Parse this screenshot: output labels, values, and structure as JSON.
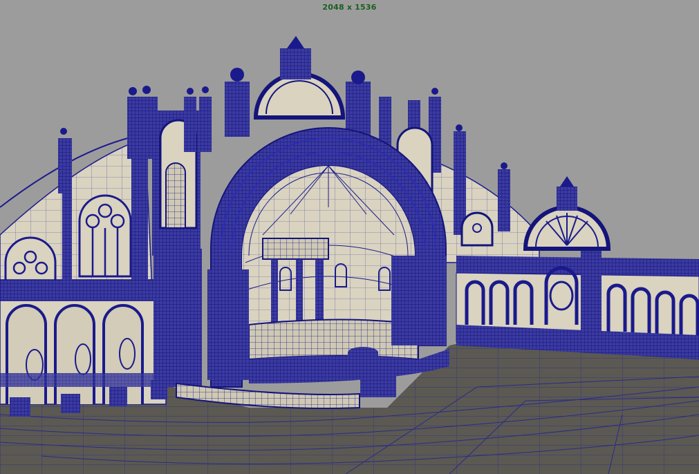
{
  "viewport": {
    "resolution_label": "2048 x 1536",
    "background_color": "#9c9c9c",
    "wire_color": "#1a1a8c",
    "surface_color": "#d8d2bf",
    "ground_color": "#595750"
  }
}
